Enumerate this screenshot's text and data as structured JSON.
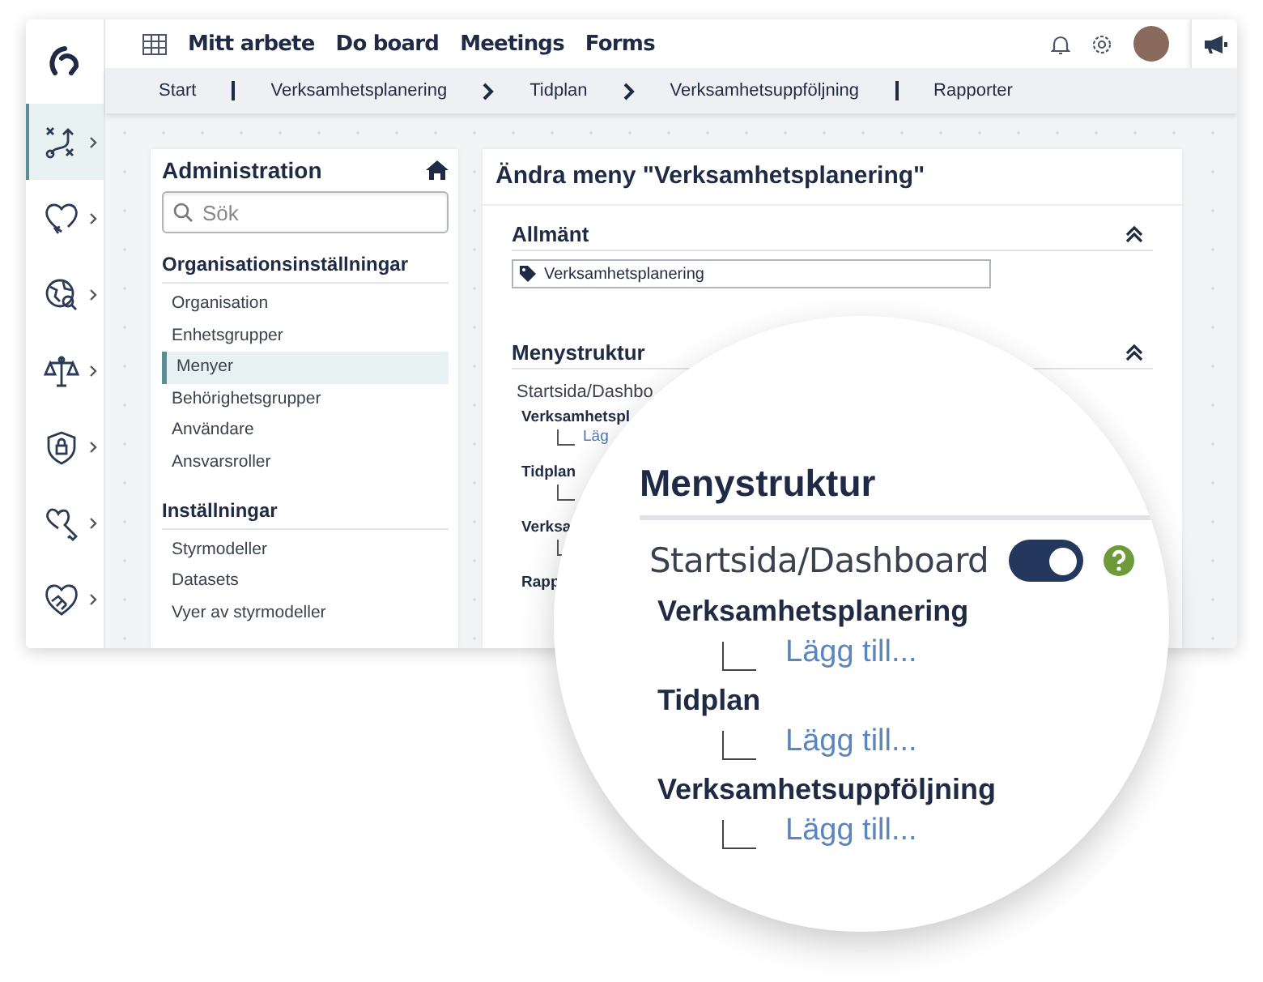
{
  "sidebar": {
    "items": [
      {
        "selected": true
      },
      {
        "selected": false
      },
      {
        "selected": false
      },
      {
        "selected": false
      },
      {
        "selected": false
      },
      {
        "selected": false
      },
      {
        "selected": false
      }
    ]
  },
  "top_nav": {
    "items": [
      "Mitt arbete",
      "Do board",
      "Meetings",
      "Forms"
    ]
  },
  "breadcrumb": [
    {
      "kind": "link",
      "label": "Start"
    },
    {
      "kind": "bar"
    },
    {
      "kind": "link",
      "label": "Verksamhetsplanering"
    },
    {
      "kind": "chevron"
    },
    {
      "kind": "link",
      "label": "Tidplan"
    },
    {
      "kind": "chevron"
    },
    {
      "kind": "link",
      "label": "Verksamhetsuppföljning"
    },
    {
      "kind": "bar"
    },
    {
      "kind": "link",
      "label": "Rapporter"
    }
  ],
  "admin_panel": {
    "title": "Administration",
    "search": {
      "placeholder": "Sök"
    },
    "sections": [
      {
        "title": "Organisationsinställningar",
        "items": [
          {
            "label": "Organisation",
            "selected": false
          },
          {
            "label": "Enhetsgrupper",
            "selected": false
          },
          {
            "label": "Menyer",
            "selected": true
          },
          {
            "label": "Behörighetsgrupper",
            "selected": false
          },
          {
            "label": "Användare",
            "selected": false
          },
          {
            "label": "Ansvarsroller",
            "selected": false
          }
        ]
      },
      {
        "title": "Inställningar",
        "items": [
          {
            "label": "Styrmodeller",
            "selected": false
          },
          {
            "label": "Datasets",
            "selected": false
          },
          {
            "label": "Vyer av styrmodeller",
            "selected": false
          }
        ]
      }
    ]
  },
  "edit_panel": {
    "title": "Ändra meny \"Verksamhetsplanering\"",
    "general": {
      "title": "Allmänt",
      "name_field": {
        "value": "Verksamhetsplanering"
      }
    },
    "menu_structure": {
      "title": "Menystruktur",
      "root": "Startsida/Dashbo",
      "items": [
        {
          "label": "Verksamhetspl",
          "add_label": "Läg"
        },
        {
          "label": "Tidplan"
        },
        {
          "label": "Verksa"
        },
        {
          "label": "Rapp"
        }
      ]
    }
  },
  "magnifier": {
    "title": "Menystruktur",
    "root": {
      "label": "Startsida/Dashboard",
      "on": true
    },
    "items": [
      {
        "label": "Verksamhetsplanering",
        "add_label": "Lägg till..."
      },
      {
        "label": "Tidplan",
        "add_label": "Lägg till..."
      },
      {
        "label": "Verksamhetsuppföljning",
        "add_label": "Lägg till..."
      }
    ]
  }
}
